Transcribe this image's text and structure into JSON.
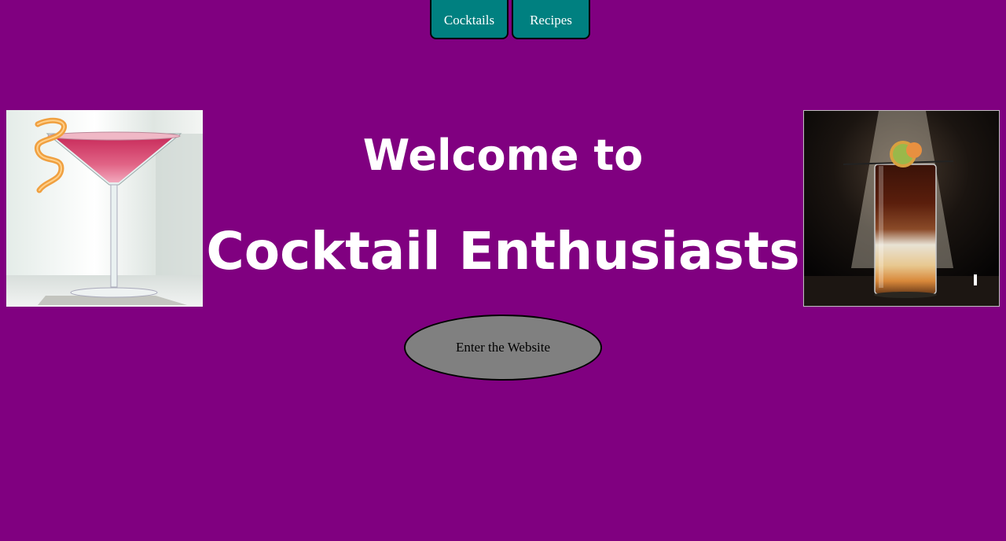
{
  "nav": {
    "items": [
      {
        "label": "Cocktails"
      },
      {
        "label": "Recipes"
      }
    ]
  },
  "hero": {
    "line1": "Welcome to",
    "line2": "Cocktail Enthusiasts"
  },
  "cta": {
    "label": "Enter the Website"
  },
  "images": {
    "left": "martini-glass-photo",
    "right": "layered-highball-photo"
  },
  "colors": {
    "background": "#800080",
    "nav_tab": "#008080",
    "button": "#808080",
    "headline": "#ffffff"
  }
}
